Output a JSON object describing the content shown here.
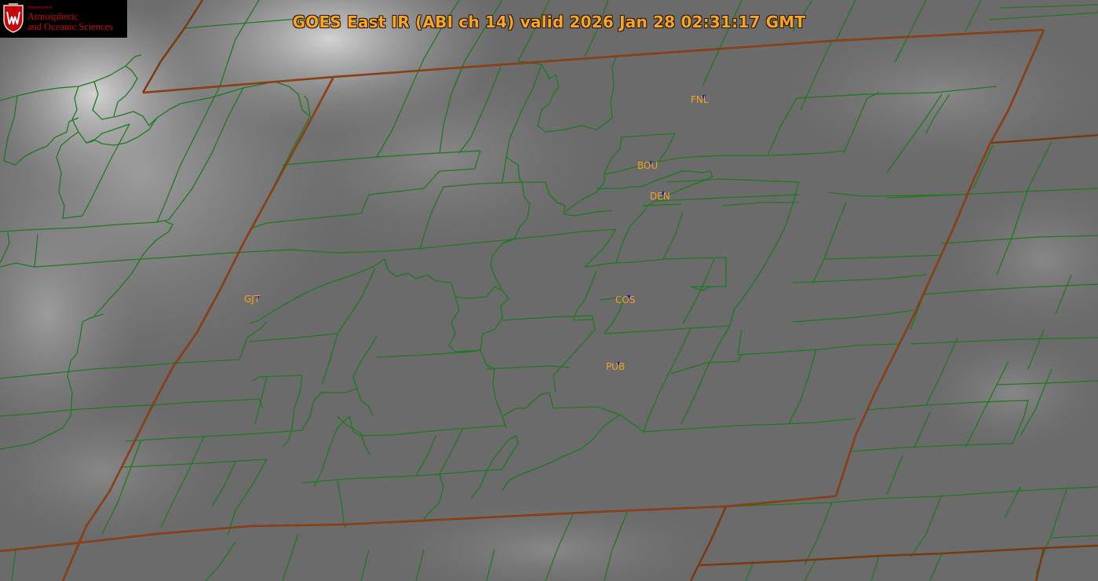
{
  "title": "GOES East IR (ABI ch 14) valid 2026 Jan 28 02:31:17 GMT",
  "logo": {
    "dept_text": "Department of",
    "line1": "Atmospheric",
    "line2": "and Oceanic Sciences",
    "crest_letter": "W"
  },
  "stations": [
    {
      "code": "FNL"
    },
    {
      "code": "BOU"
    },
    {
      "code": "DEN"
    },
    {
      "code": "GJT"
    },
    {
      "code": "COS"
    },
    {
      "code": "PUB"
    }
  ],
  "colors": {
    "state_border": "#8b3a0e",
    "county_border": "#1e7a1e",
    "label": "#f5a623",
    "station_marker": "#1020d0",
    "logo_red": "#c5050c"
  }
}
